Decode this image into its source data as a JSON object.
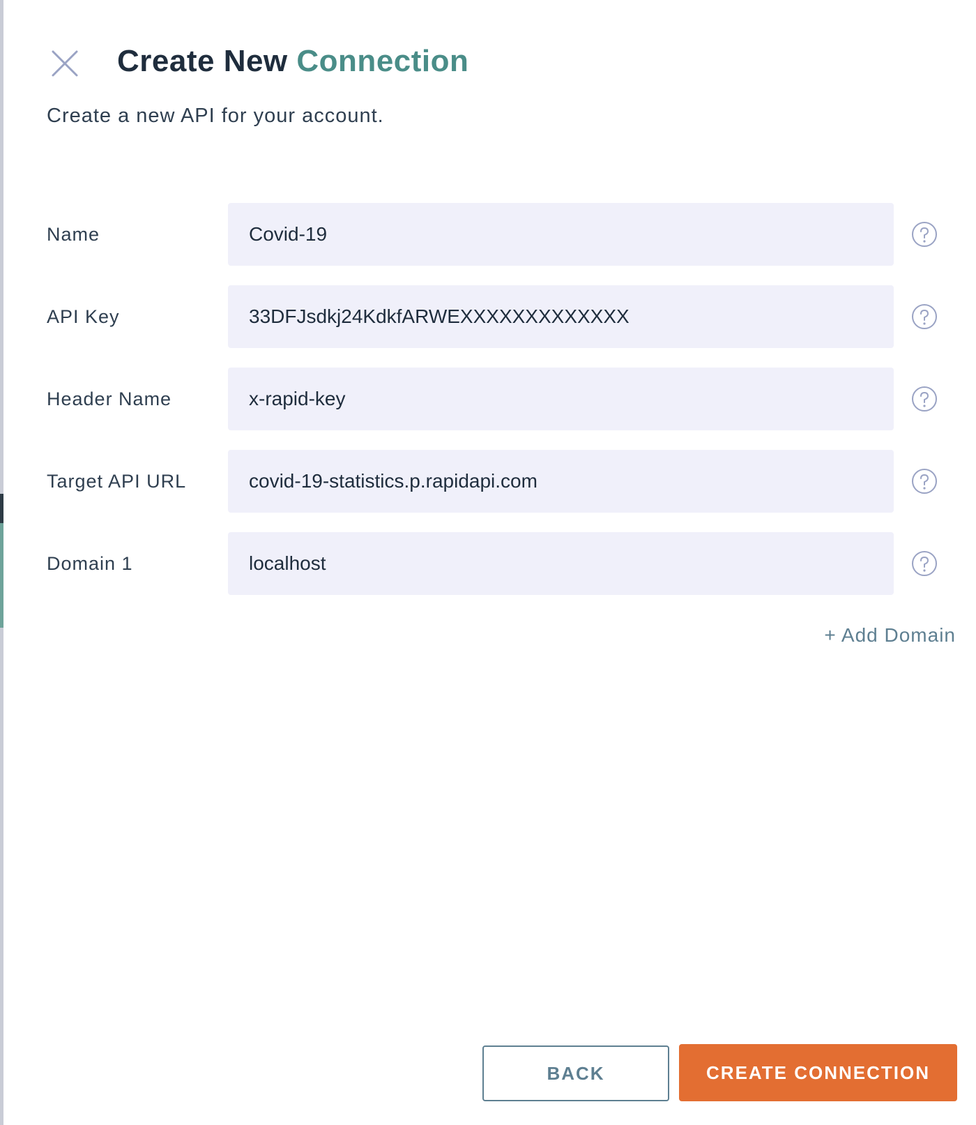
{
  "dialog": {
    "title_main": "Create New",
    "title_accent": "Connection",
    "subtitle": "Create a new API for your account.",
    "close_icon": "close-icon"
  },
  "fields": [
    {
      "label": "Name",
      "value": "Covid-19",
      "help_icon": "help-icon"
    },
    {
      "label": "API Key",
      "value": "33DFJsdkj24KdkfARWEXXXXXXXXXXXXX",
      "help_icon": "help-icon"
    },
    {
      "label": "Header Name",
      "value": "x-rapid-key",
      "help_icon": "help-icon"
    },
    {
      "label": "Target API URL",
      "value": "covid-19-statistics.p.rapidapi.com",
      "help_icon": "help-icon"
    },
    {
      "label": "Domain 1",
      "value": "localhost",
      "help_icon": "help-icon"
    }
  ],
  "add_domain_label": "+ Add Domain",
  "actions": {
    "back_label": "BACK",
    "create_label": "CREATE CONNECTION"
  },
  "colors": {
    "accent": "#4a8d88",
    "primary_button": "#e36e32",
    "input_background": "#f0f0fa",
    "secondary_text": "#5e7f91"
  }
}
